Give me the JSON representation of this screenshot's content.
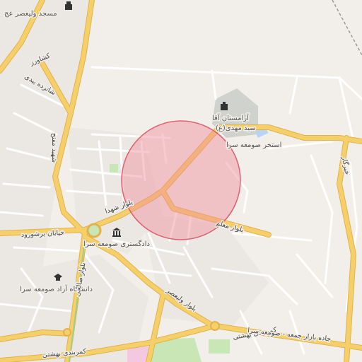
{
  "map": {
    "type": "street-map",
    "language": "fa",
    "colors": {
      "background": "#f2efea",
      "major_road": "#f4cf6a",
      "major_road_casing": "#e3b24a",
      "minor_road": "#ffffff",
      "minor_road_casing": "#d6d1c9",
      "park": "#c9e6b6",
      "cemetery": "#d0d3cd",
      "water": "#b7d4f4",
      "railway": "#9a9a9a",
      "highlight_fill": "#f08c98",
      "highlight_stroke": "#e06070"
    },
    "highlight": {
      "shape": "circle",
      "color": "#e06070"
    },
    "labels": {
      "mosque": "مسجد ولیعصر عج",
      "keshavarz": "کشاورز",
      "shatarzadeh": "شاترده بیدی",
      "shahid_mofatteh": "شهید مفتح",
      "cemetery": "آرامستان آقا سید مهدی(ع)",
      "swimming_pool": "استخر صومعه سرا",
      "kheirkar": "خیرگار",
      "boulevard_shohada": "بلوار شهدا",
      "boulevard_moallem": "بلوار معلم",
      "khiaban_borshorud": "خیابان برشورود",
      "courthouse": "دادگستری صومعه سرا",
      "azad_university": "دانشگاه آزاد صومعه سرا",
      "boulevard_salehi": "بلوار صالحی",
      "boulevard_valiasr": "بلوار ولیعصر",
      "kamarbandi_1": "کمربندی بهشتی",
      "kamarbandi_2": "کمربندی بهشتی",
      "jadeh_bazar": "جاده بازار جمعه - صومعه سرا"
    },
    "icons": {
      "mosque": "mosque-icon",
      "cemetery": "cemetery-icon",
      "courthouse": "courthouse-icon",
      "university": "university-icon"
    }
  }
}
